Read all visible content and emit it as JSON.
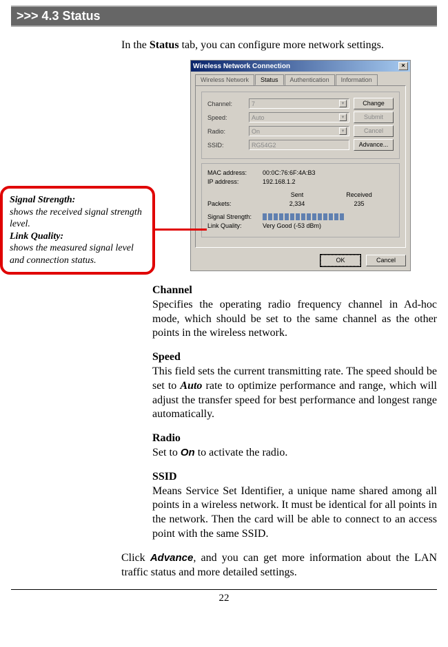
{
  "header": {
    "title": ">>> 4.3  Status"
  },
  "intro": {
    "pre": "In the ",
    "bold": "Status",
    "post": " tab, you can configure more network settings."
  },
  "dialog": {
    "title": "Wireless Network Connection",
    "tabs": [
      "Wireless Network",
      "Status",
      "Authentication",
      "Information"
    ],
    "active_tab": 1,
    "fields": {
      "channel_label": "Channel:",
      "channel_value": "7",
      "speed_label": "Speed:",
      "speed_value": "Auto",
      "radio_label": "Radio:",
      "radio_value": "On",
      "ssid_label": "SSID:",
      "ssid_value": "RG54G2"
    },
    "buttons": {
      "change": "Change",
      "submit": "Submit",
      "cancel": "Cancel",
      "advance": "Advance..."
    },
    "info": {
      "mac_label": "MAC address:",
      "mac_value": "00:0C:76:6F:4A:B3",
      "ip_label": "IP address:",
      "ip_value": "192.168.1.2",
      "sent_label": "Sent",
      "recv_label": "Received",
      "packets_label": "Packets:",
      "packets_sent": "2,334",
      "packets_recv": "235",
      "sig_label": "Signal Strength:",
      "lq_label": "Link Quality:",
      "lq_value": "Very Good (-53 dBm)"
    },
    "bottom": {
      "ok": "OK",
      "cancel": "Cancel"
    }
  },
  "callout": {
    "t1": "Signal Strength:",
    "d1": "shows the received signal strength level.",
    "t2": "Link Quality:",
    "d2": "shows the measured signal level and connection status."
  },
  "sections": {
    "channel_h": "Channel",
    "channel_b": "Specifies the operating radio frequency channel in Ad-hoc mode, which should be set to the same channel as the other points in the wireless network.",
    "speed_h": "Speed",
    "speed_b1": "This field sets the current transmitting rate.  The speed should be set to ",
    "speed_em": "Auto",
    "speed_b2": " rate to optimize performance and range, which will adjust the transfer speed for best perfor­mance and longest range automatically.",
    "radio_h": "Radio",
    "radio_b1": "Set to ",
    "radio_em": "On",
    "radio_b2": " to activate the radio.",
    "ssid_h": "SSID",
    "ssid_b": "Means Service Set Identifier, a unique name shared among all points in a wireless network. It must be identical for all points in the network.  Then the card  will be able to connect to an access point with the same SSID."
  },
  "footer": {
    "pre": "Click ",
    "em": "Advance",
    "post": ", and you can get more information about the LAN traffic status and more detailed settings."
  },
  "page_number": "22"
}
